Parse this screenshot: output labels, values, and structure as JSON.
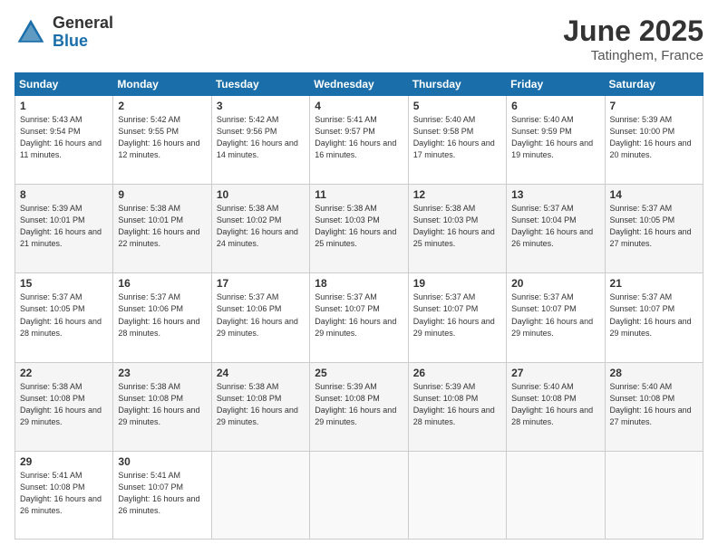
{
  "logo": {
    "general": "General",
    "blue": "Blue"
  },
  "header": {
    "month": "June 2025",
    "location": "Tatinghem, France"
  },
  "weekdays": [
    "Sunday",
    "Monday",
    "Tuesday",
    "Wednesday",
    "Thursday",
    "Friday",
    "Saturday"
  ],
  "rows": [
    [
      {
        "day": "1",
        "sunrise": "Sunrise: 5:43 AM",
        "sunset": "Sunset: 9:54 PM",
        "daylight": "Daylight: 16 hours and 11 minutes."
      },
      {
        "day": "2",
        "sunrise": "Sunrise: 5:42 AM",
        "sunset": "Sunset: 9:55 PM",
        "daylight": "Daylight: 16 hours and 12 minutes."
      },
      {
        "day": "3",
        "sunrise": "Sunrise: 5:42 AM",
        "sunset": "Sunset: 9:56 PM",
        "daylight": "Daylight: 16 hours and 14 minutes."
      },
      {
        "day": "4",
        "sunrise": "Sunrise: 5:41 AM",
        "sunset": "Sunset: 9:57 PM",
        "daylight": "Daylight: 16 hours and 16 minutes."
      },
      {
        "day": "5",
        "sunrise": "Sunrise: 5:40 AM",
        "sunset": "Sunset: 9:58 PM",
        "daylight": "Daylight: 16 hours and 17 minutes."
      },
      {
        "day": "6",
        "sunrise": "Sunrise: 5:40 AM",
        "sunset": "Sunset: 9:59 PM",
        "daylight": "Daylight: 16 hours and 19 minutes."
      },
      {
        "day": "7",
        "sunrise": "Sunrise: 5:39 AM",
        "sunset": "Sunset: 10:00 PM",
        "daylight": "Daylight: 16 hours and 20 minutes."
      }
    ],
    [
      {
        "day": "8",
        "sunrise": "Sunrise: 5:39 AM",
        "sunset": "Sunset: 10:01 PM",
        "daylight": "Daylight: 16 hours and 21 minutes."
      },
      {
        "day": "9",
        "sunrise": "Sunrise: 5:38 AM",
        "sunset": "Sunset: 10:01 PM",
        "daylight": "Daylight: 16 hours and 22 minutes."
      },
      {
        "day": "10",
        "sunrise": "Sunrise: 5:38 AM",
        "sunset": "Sunset: 10:02 PM",
        "daylight": "Daylight: 16 hours and 24 minutes."
      },
      {
        "day": "11",
        "sunrise": "Sunrise: 5:38 AM",
        "sunset": "Sunset: 10:03 PM",
        "daylight": "Daylight: 16 hours and 25 minutes."
      },
      {
        "day": "12",
        "sunrise": "Sunrise: 5:38 AM",
        "sunset": "Sunset: 10:03 PM",
        "daylight": "Daylight: 16 hours and 25 minutes."
      },
      {
        "day": "13",
        "sunrise": "Sunrise: 5:37 AM",
        "sunset": "Sunset: 10:04 PM",
        "daylight": "Daylight: 16 hours and 26 minutes."
      },
      {
        "day": "14",
        "sunrise": "Sunrise: 5:37 AM",
        "sunset": "Sunset: 10:05 PM",
        "daylight": "Daylight: 16 hours and 27 minutes."
      }
    ],
    [
      {
        "day": "15",
        "sunrise": "Sunrise: 5:37 AM",
        "sunset": "Sunset: 10:05 PM",
        "daylight": "Daylight: 16 hours and 28 minutes."
      },
      {
        "day": "16",
        "sunrise": "Sunrise: 5:37 AM",
        "sunset": "Sunset: 10:06 PM",
        "daylight": "Daylight: 16 hours and 28 minutes."
      },
      {
        "day": "17",
        "sunrise": "Sunrise: 5:37 AM",
        "sunset": "Sunset: 10:06 PM",
        "daylight": "Daylight: 16 hours and 29 minutes."
      },
      {
        "day": "18",
        "sunrise": "Sunrise: 5:37 AM",
        "sunset": "Sunset: 10:07 PM",
        "daylight": "Daylight: 16 hours and 29 minutes."
      },
      {
        "day": "19",
        "sunrise": "Sunrise: 5:37 AM",
        "sunset": "Sunset: 10:07 PM",
        "daylight": "Daylight: 16 hours and 29 minutes."
      },
      {
        "day": "20",
        "sunrise": "Sunrise: 5:37 AM",
        "sunset": "Sunset: 10:07 PM",
        "daylight": "Daylight: 16 hours and 29 minutes."
      },
      {
        "day": "21",
        "sunrise": "Sunrise: 5:37 AM",
        "sunset": "Sunset: 10:07 PM",
        "daylight": "Daylight: 16 hours and 29 minutes."
      }
    ],
    [
      {
        "day": "22",
        "sunrise": "Sunrise: 5:38 AM",
        "sunset": "Sunset: 10:08 PM",
        "daylight": "Daylight: 16 hours and 29 minutes."
      },
      {
        "day": "23",
        "sunrise": "Sunrise: 5:38 AM",
        "sunset": "Sunset: 10:08 PM",
        "daylight": "Daylight: 16 hours and 29 minutes."
      },
      {
        "day": "24",
        "sunrise": "Sunrise: 5:38 AM",
        "sunset": "Sunset: 10:08 PM",
        "daylight": "Daylight: 16 hours and 29 minutes."
      },
      {
        "day": "25",
        "sunrise": "Sunrise: 5:39 AM",
        "sunset": "Sunset: 10:08 PM",
        "daylight": "Daylight: 16 hours and 29 minutes."
      },
      {
        "day": "26",
        "sunrise": "Sunrise: 5:39 AM",
        "sunset": "Sunset: 10:08 PM",
        "daylight": "Daylight: 16 hours and 28 minutes."
      },
      {
        "day": "27",
        "sunrise": "Sunrise: 5:40 AM",
        "sunset": "Sunset: 10:08 PM",
        "daylight": "Daylight: 16 hours and 28 minutes."
      },
      {
        "day": "28",
        "sunrise": "Sunrise: 5:40 AM",
        "sunset": "Sunset: 10:08 PM",
        "daylight": "Daylight: 16 hours and 27 minutes."
      }
    ],
    [
      {
        "day": "29",
        "sunrise": "Sunrise: 5:41 AM",
        "sunset": "Sunset: 10:08 PM",
        "daylight": "Daylight: 16 hours and 26 minutes."
      },
      {
        "day": "30",
        "sunrise": "Sunrise: 5:41 AM",
        "sunset": "Sunset: 10:07 PM",
        "daylight": "Daylight: 16 hours and 26 minutes."
      },
      null,
      null,
      null,
      null,
      null
    ]
  ]
}
